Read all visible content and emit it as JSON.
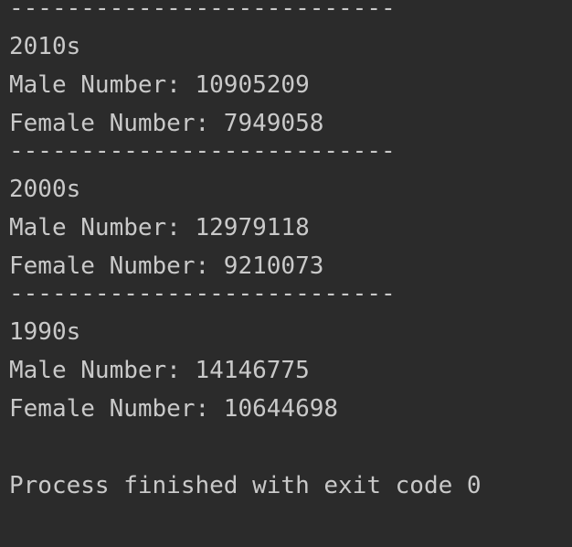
{
  "console": {
    "separator": "---------------------------",
    "blocks": [
      {
        "decade": "2010s",
        "male": "Male Number: 10905209",
        "female": "Female Number: 7949058"
      },
      {
        "decade": "2000s",
        "male": "Male Number: 12979118",
        "female": "Female Number: 9210073"
      },
      {
        "decade": "1990s",
        "male": "Male Number: 14146775",
        "female": "Female Number: 10644698"
      }
    ],
    "status": "Process finished with exit code 0"
  }
}
